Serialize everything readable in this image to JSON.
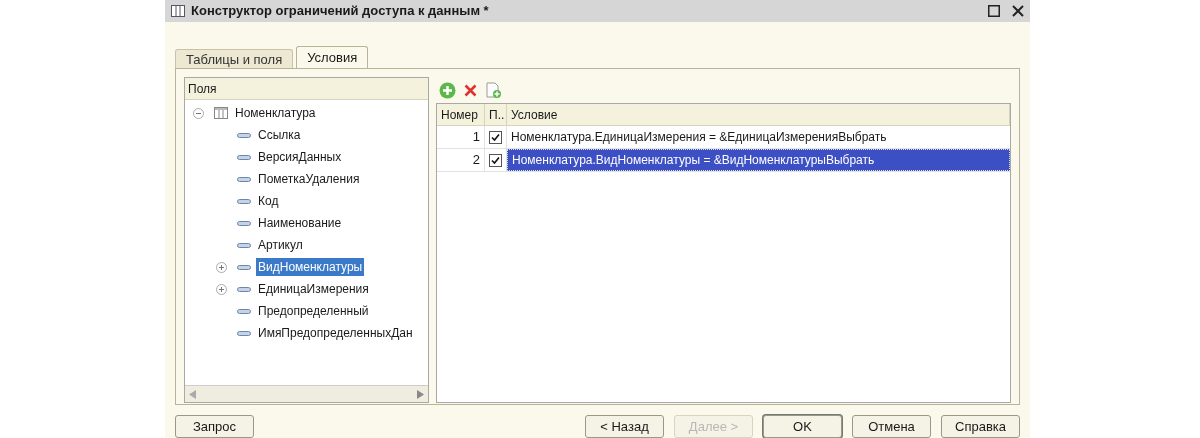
{
  "window": {
    "title": "Конструктор ограничений доступа к данным *"
  },
  "tabs": [
    {
      "label": "Таблицы и поля",
      "selected": false
    },
    {
      "label": "Условия",
      "selected": true
    }
  ],
  "fields_panel": {
    "header": "Поля",
    "tree": [
      {
        "label": "Номенклатура",
        "kind": "table",
        "expanded": true,
        "selected": false,
        "children": [
          {
            "label": "Ссылка",
            "kind": "field",
            "expandable": false,
            "selected": false
          },
          {
            "label": "ВерсияДанных",
            "kind": "field",
            "expandable": false,
            "selected": false
          },
          {
            "label": "ПометкаУдаления",
            "kind": "field",
            "expandable": false,
            "selected": false
          },
          {
            "label": "Код",
            "kind": "field",
            "expandable": false,
            "selected": false
          },
          {
            "label": "Наименование",
            "kind": "field",
            "expandable": false,
            "selected": false
          },
          {
            "label": "Артикул",
            "kind": "field",
            "expandable": false,
            "selected": false
          },
          {
            "label": "ВидНоменклатуры",
            "kind": "field",
            "expandable": true,
            "selected": true
          },
          {
            "label": "ЕдиницаИзмерения",
            "kind": "field",
            "expandable": true,
            "selected": false
          },
          {
            "label": "Предопределенный",
            "kind": "field",
            "expandable": false,
            "selected": false
          },
          {
            "label": "ИмяПредопределенныхДан",
            "kind": "field",
            "expandable": false,
            "selected": false
          }
        ]
      }
    ]
  },
  "conditions_table": {
    "columns": [
      "Номер",
      "П..",
      "Условие"
    ],
    "rows": [
      {
        "number": "1",
        "checked": true,
        "condition": "Номенклатура.ЕдиницаИзмерения = &ЕдиницаИзмеренияВыбрать",
        "selected": false
      },
      {
        "number": "2",
        "checked": true,
        "condition": "Номенклатура.ВидНоменклатуры = &ВидНоменклатурыВыбрать",
        "selected": true
      }
    ]
  },
  "buttons": [
    {
      "label": "Запрос",
      "disabled": false,
      "default": false
    },
    {
      "label": "< Назад",
      "disabled": false,
      "default": false
    },
    {
      "label": "Далее >",
      "disabled": true,
      "default": false
    },
    {
      "label": "OK",
      "disabled": false,
      "default": true
    },
    {
      "label": "Отмена",
      "disabled": false,
      "default": false
    },
    {
      "label": "Справка",
      "disabled": false,
      "default": false
    }
  ]
}
